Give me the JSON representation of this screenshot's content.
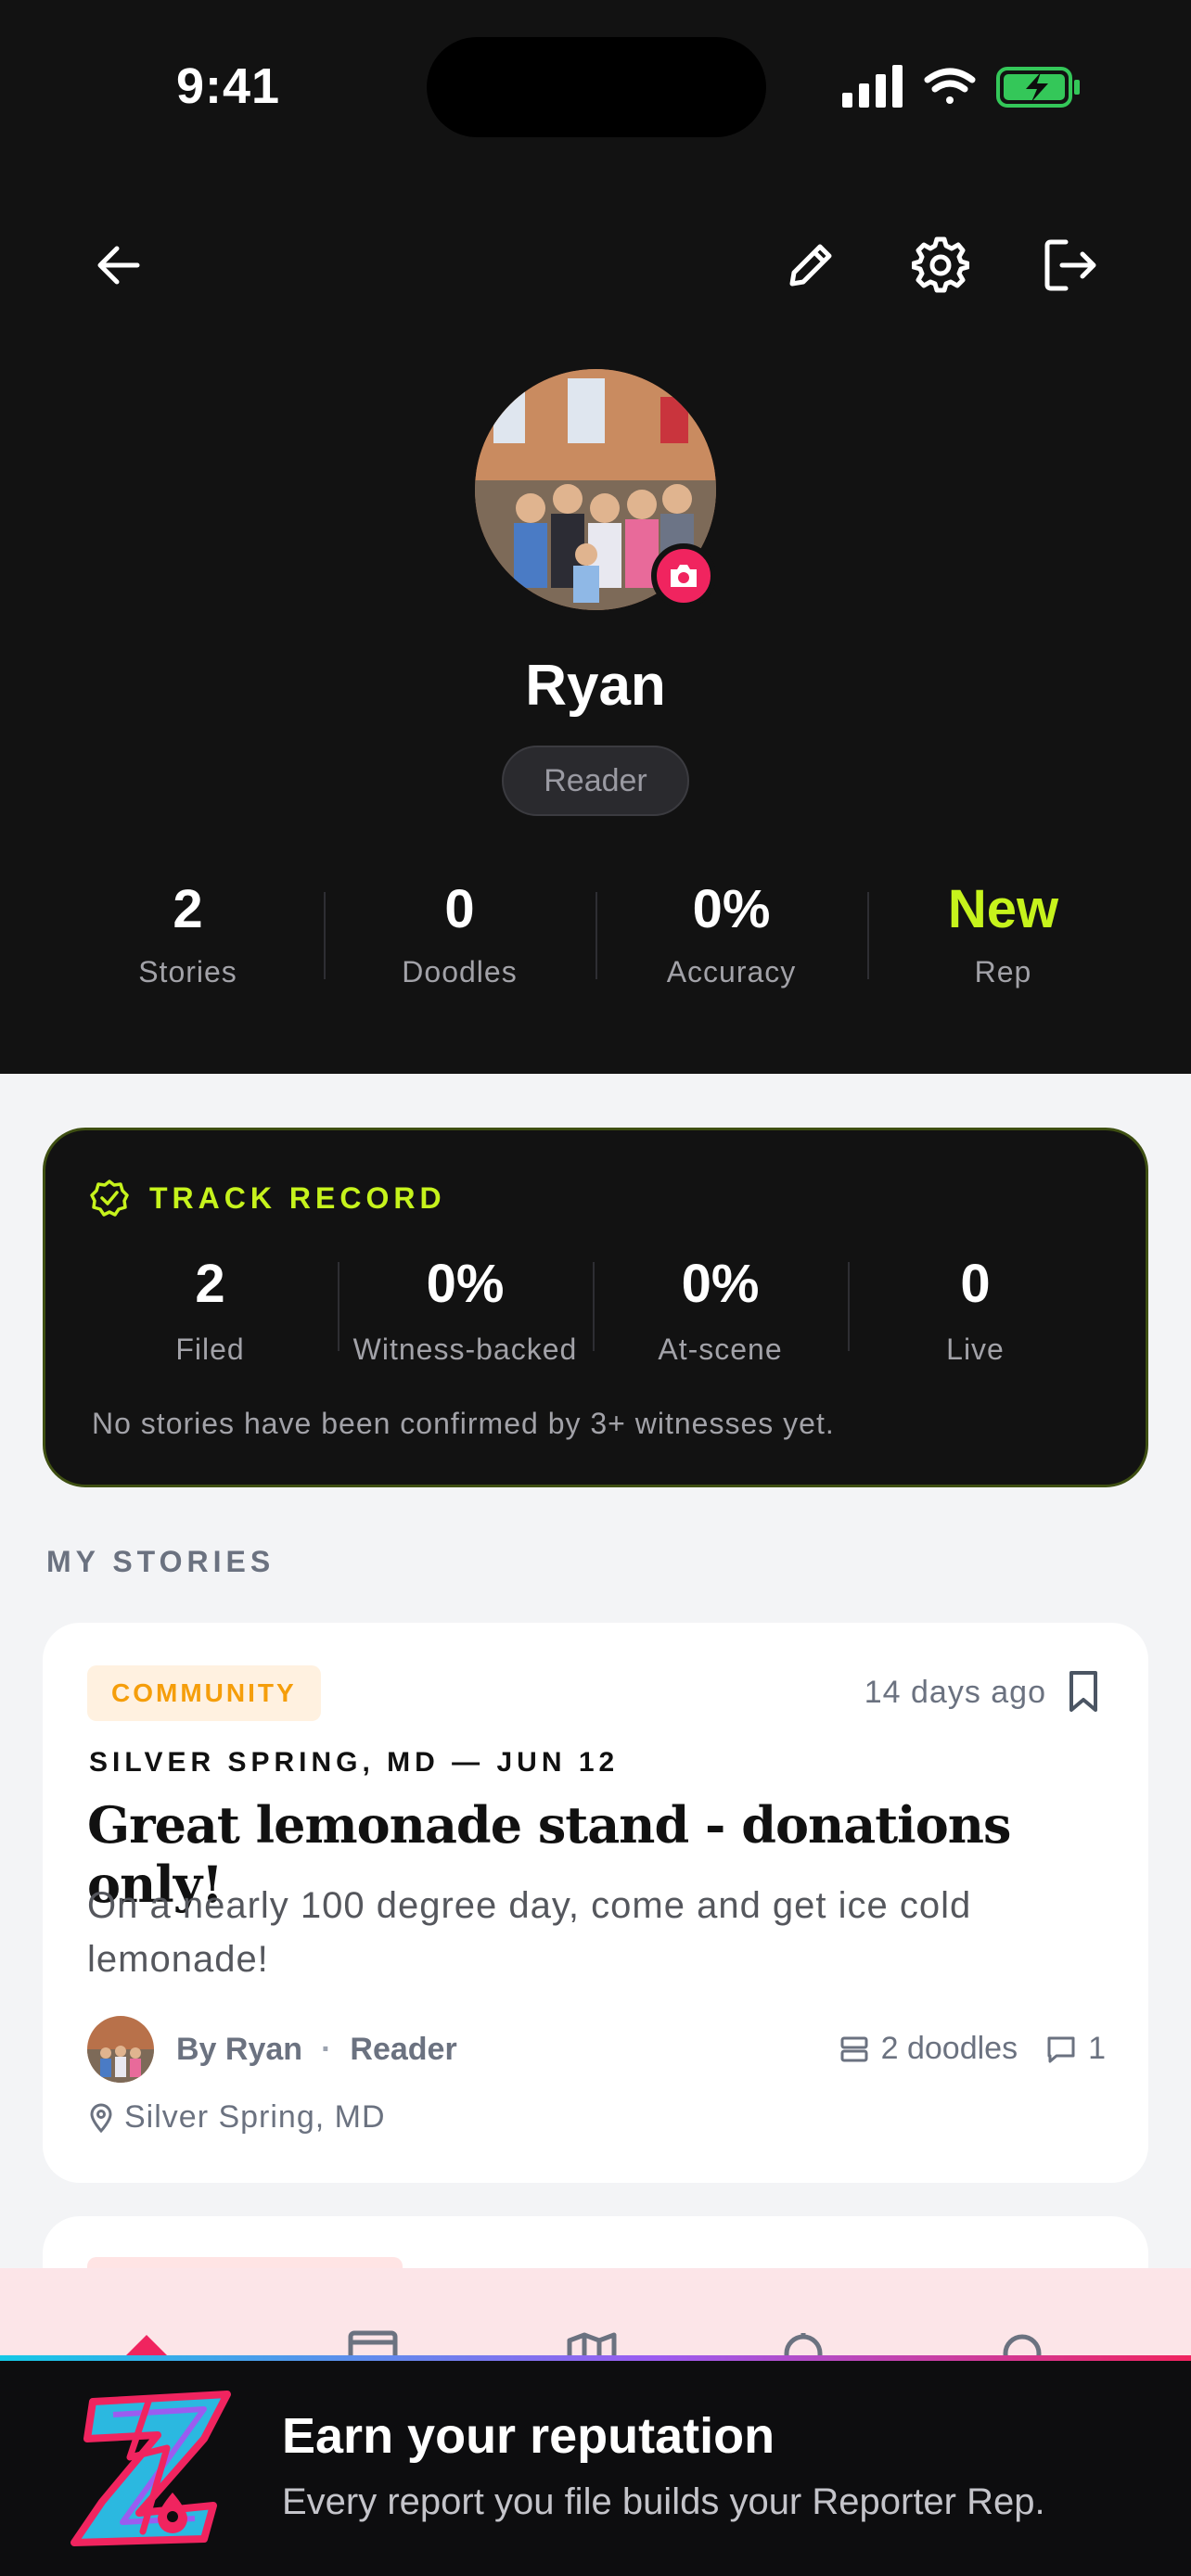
{
  "status_bar": {
    "time": "9:41"
  },
  "profile": {
    "name": "Ryan",
    "role": "Reader",
    "stats": [
      {
        "value": "2",
        "label": "Stories"
      },
      {
        "value": "0",
        "label": "Doodles"
      },
      {
        "value": "0%",
        "label": "Accuracy"
      },
      {
        "value": "New",
        "label": "Rep"
      }
    ]
  },
  "track_record": {
    "title": "TRACK RECORD",
    "stats": [
      {
        "value": "2",
        "label": "Filed"
      },
      {
        "value": "0%",
        "label": "Witness-backed"
      },
      {
        "value": "0%",
        "label": "At-scene"
      },
      {
        "value": "0",
        "label": "Live"
      }
    ],
    "note": "No stories have been confirmed by 3+ witnesses yet."
  },
  "my_stories": {
    "section_title": "MY STORIES",
    "stories": [
      {
        "tag": "COMMUNITY",
        "time_ago": "14 days ago",
        "dateline": "SILVER SPRING, MD — JUN 12",
        "headline": "Great lemonade stand - donations only!",
        "summary": "On a nearly 100 degree day, come and get ice cold lemonade!",
        "author": "By Ryan",
        "author_role": "Reader",
        "doodles": "2 doodles",
        "comments": "1",
        "location": "Silver Spring, MD"
      }
    ]
  },
  "banner": {
    "title": "Earn your reputation",
    "subtitle": "Every report you file builds your Reporter Rep."
  },
  "colors": {
    "accent_green": "#c6f31c",
    "accent_pink": "#f0245f",
    "tag_orange": "#f59e0b",
    "dark_bg": "#121212"
  },
  "icons": {
    "back": "arrow-left-icon",
    "edit": "pencil-icon",
    "settings": "gear-icon",
    "logout": "logout-icon",
    "camera": "camera-icon",
    "track": "verified-badge-icon",
    "bookmark": "bookmark-icon",
    "doodles": "layers-icon",
    "comments": "comment-icon",
    "location": "map-pin-icon"
  }
}
